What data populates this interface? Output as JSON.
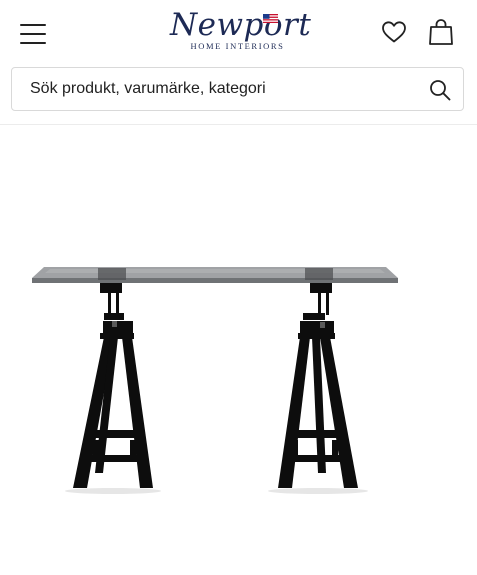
{
  "header": {
    "brand": {
      "name": "Newport",
      "tagline": "HOME INTERIORS",
      "color": "#1d2a55"
    },
    "icons": {
      "menu": "menu-icon",
      "wishlist": "heart-icon",
      "cart": "shopping-bag-icon",
      "flag": "us-flag-icon"
    }
  },
  "search": {
    "placeholder": "Sök produkt, varumärke, kategori",
    "icon": "search-icon"
  },
  "product": {
    "image": "glass-top-desk-on-black-trestles"
  }
}
